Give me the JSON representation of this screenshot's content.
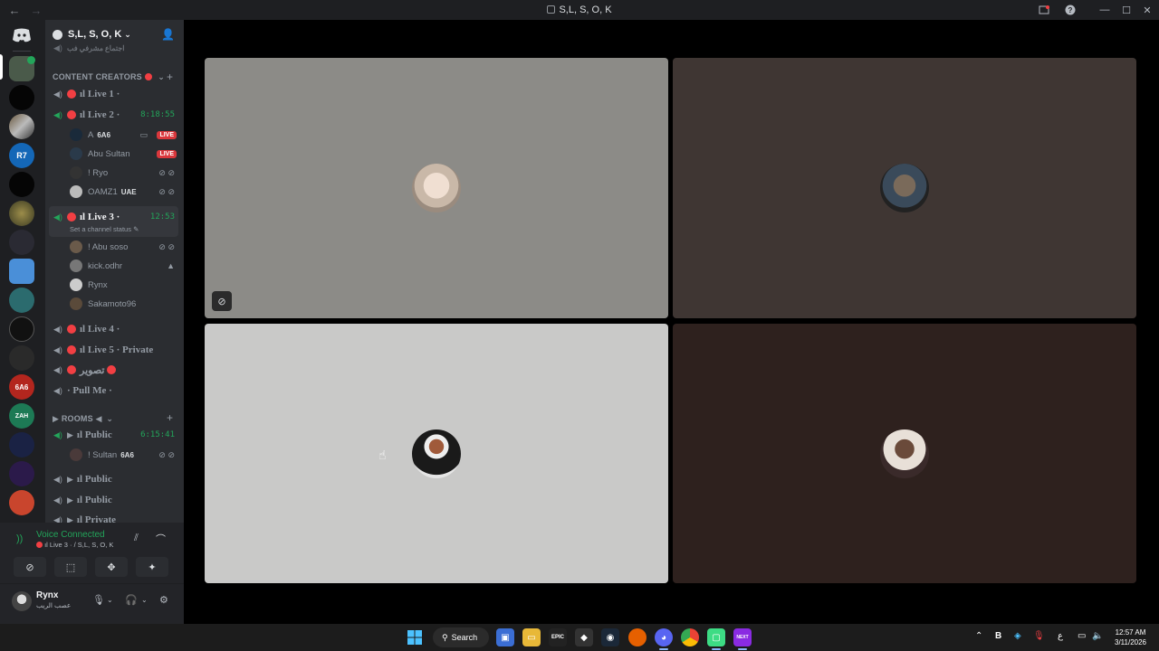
{
  "window": {
    "title": "S,L, S, O, K",
    "back": "←",
    "forward": "→"
  },
  "server": {
    "name": "S,L, S, O, K",
    "chevron": "⌄"
  },
  "sidebar": {
    "top_fade_text": "اجتماع مشرفي فب",
    "category_content": "CONTENT CREATORS",
    "channels": [
      {
        "name": "ıl Live 1 ·"
      },
      {
        "name": "ıl Live 2 ·",
        "timer": "8:18:55"
      },
      {
        "name": "ıl Live 3 ·",
        "timer": "12:53",
        "status": "Set a channel status"
      },
      {
        "name": "ıl Live 4 ·"
      },
      {
        "name": "ıl Live 5 · Private"
      },
      {
        "name": "تصوير"
      },
      {
        "name": "· Pull Me ·"
      }
    ],
    "live2_users": [
      {
        "name": "A",
        "tag": "6A6",
        "badge": "LIVE"
      },
      {
        "name": "Abu Sultan",
        "badge": "LIVE"
      },
      {
        "name": "! Ryo"
      },
      {
        "name": "OAMZ1",
        "tag": "UAE"
      }
    ],
    "live3_users": [
      {
        "name": "! Abu soso"
      },
      {
        "name": "kick.odhr"
      },
      {
        "name": "Rynx"
      },
      {
        "name": "Sakamoto96"
      }
    ],
    "category_rooms": "ROOMS ◀",
    "rooms": [
      {
        "name": "ıl Public",
        "timer": "6:15:41"
      },
      {
        "name": "ıl Public"
      },
      {
        "name": "ıl Public"
      },
      {
        "name": "ıl Private"
      }
    ],
    "rooms_users": [
      {
        "name": "! Sultan",
        "tag": "6A6"
      }
    ]
  },
  "voice": {
    "status": "Voice Connected",
    "channel": "ıl Live 3 · / S,L, S, O, K"
  },
  "user": {
    "name": "Rynx",
    "status": "عصب الريب"
  },
  "taskbar": {
    "search": "Search",
    "time": "12:57 AM",
    "date": "3/11/2026",
    "lang": "ع",
    "next_label": "NEXT",
    "epic_label": "EPIC"
  },
  "colors": {
    "rail": "#1e1f22",
    "sidebar": "#2b2d31",
    "accent_green": "#23a55a",
    "live_red": "#da373c",
    "tile1": "#8c8b87",
    "tile2": "#3f3633",
    "tile3": "#c9c9c8",
    "tile4": "#2e211e"
  }
}
